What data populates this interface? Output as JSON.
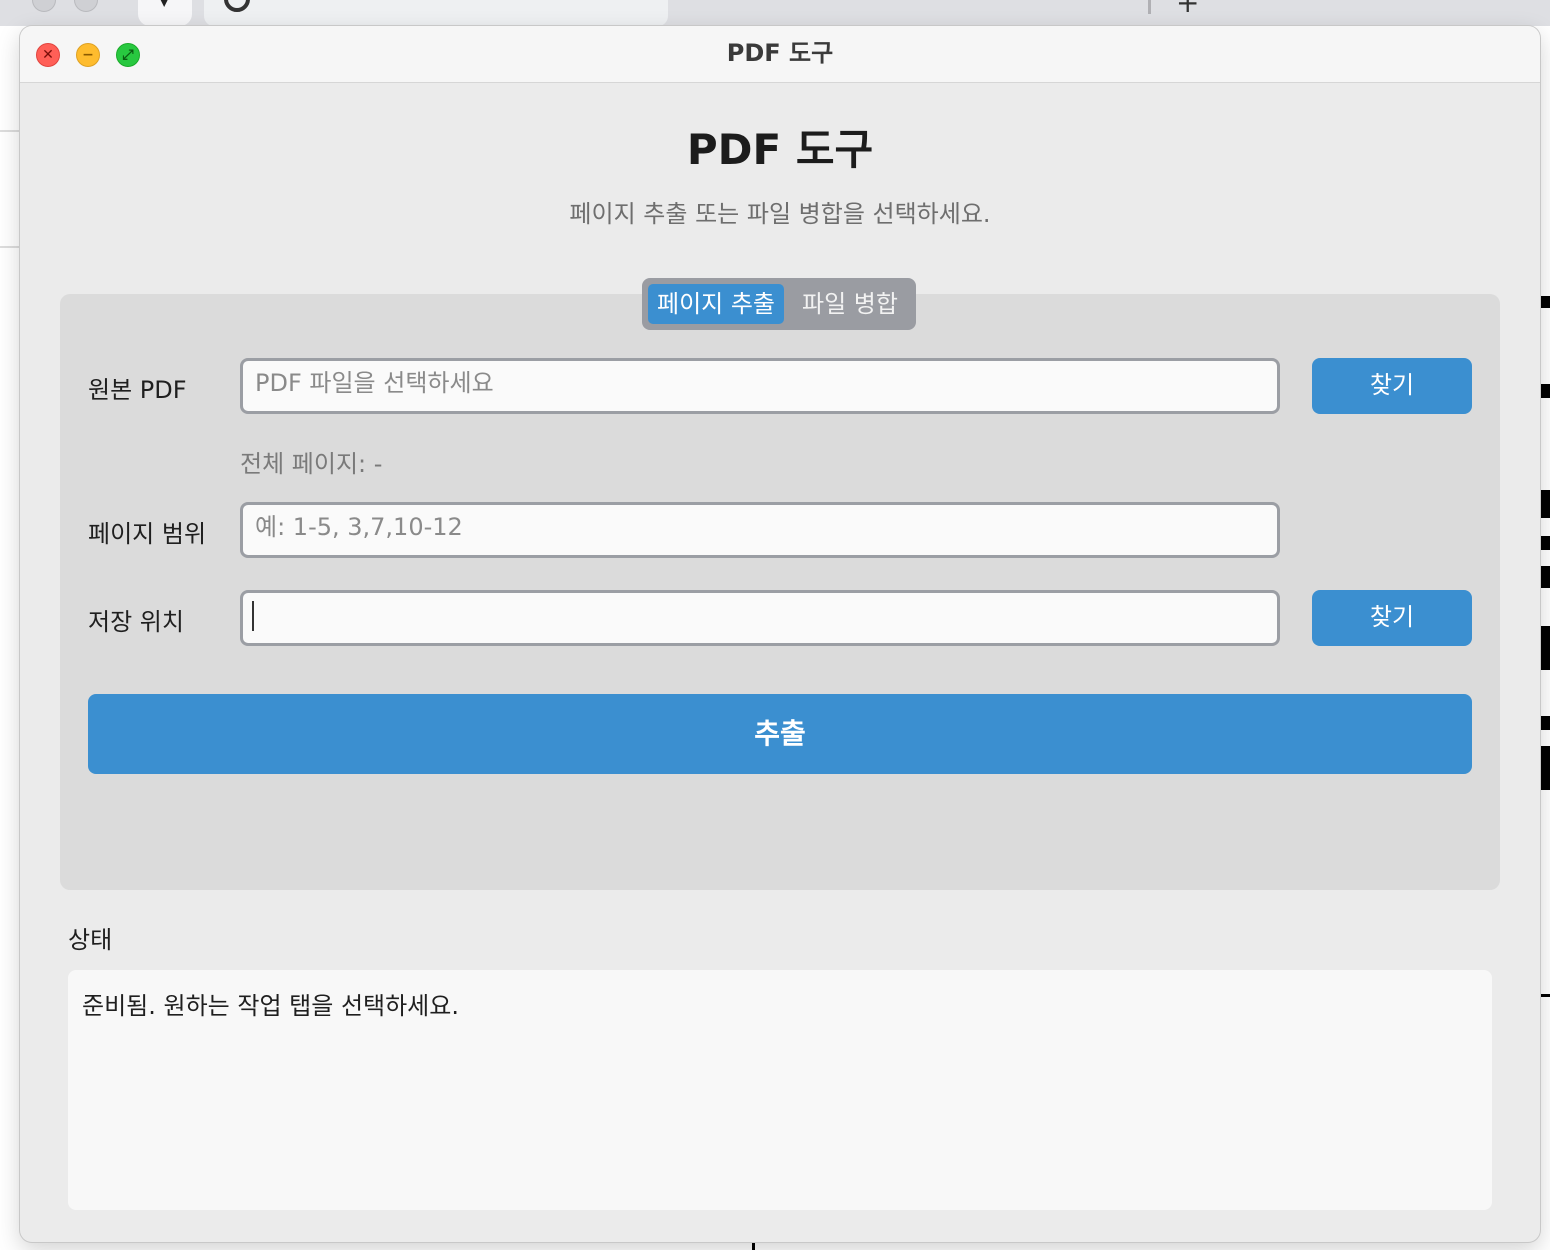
{
  "window": {
    "title": "PDF 도구"
  },
  "header": {
    "title": "PDF 도구",
    "subtitle": "페이지 추출 또는 파일 병합을 선택하세요."
  },
  "tabs": [
    {
      "label": "페이지 추출",
      "active": true
    },
    {
      "label": "파일 병합",
      "active": false
    }
  ],
  "form": {
    "source_label": "원본 PDF",
    "source_placeholder": "PDF 파일을 선택하세요",
    "source_value": "",
    "source_browse_label": "찾기",
    "total_pages_text": "전체 페이지: -",
    "range_label": "페이지 범위",
    "range_placeholder": "예: 1-5, 3,7,10-12",
    "range_value": "",
    "save_label": "저장 위치",
    "save_value": "",
    "save_browse_label": "찾기",
    "action_label": "추출"
  },
  "status": {
    "label": "상태",
    "text": "준비됨. 원하는 작업 탭을 선택하세요."
  },
  "colors": {
    "accent": "#3b8fd0",
    "panel": "#dbdbdb",
    "window_bg": "#ebebeb",
    "close": "#ff5f57",
    "minimize": "#febc2e",
    "maximize": "#28c840"
  }
}
